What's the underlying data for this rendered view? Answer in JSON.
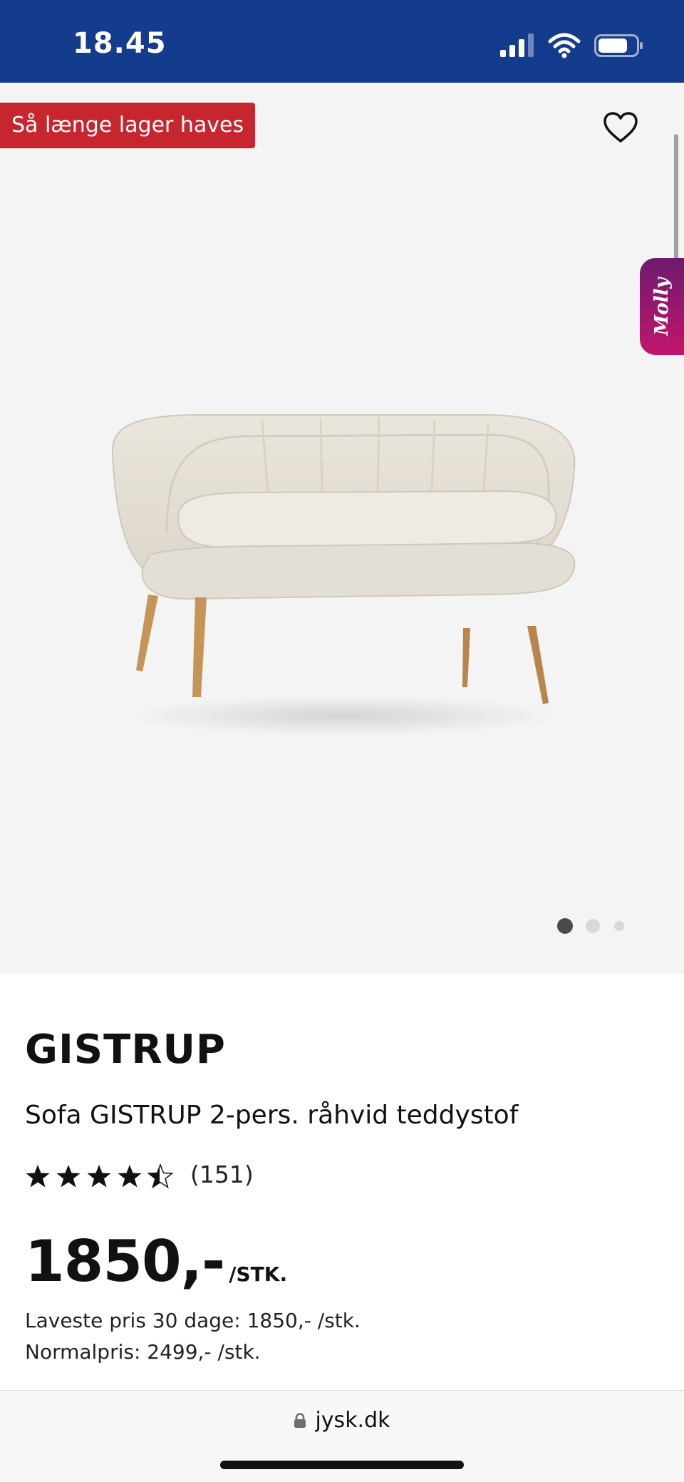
{
  "status_bar": {
    "time": "18.45",
    "background": "#143c8c"
  },
  "gallery": {
    "badge": "Så længe lager haves",
    "badge_color": "#c8262e",
    "assistant_tab_label": "Molly",
    "image_count": 3,
    "active_image": 1
  },
  "product": {
    "brand": "GISTRUP",
    "name": "Sofa GISTRUP 2-pers. råhvid teddystof",
    "rating": 4.5,
    "rating_max": 5,
    "review_count": "(151)",
    "price": "1850,-",
    "price_unit": "/STK.",
    "lowest_price": "Laveste pris 30 dage: 1850,- /stk.",
    "normal_price": "Normalpris: 2499,- /stk."
  },
  "browser": {
    "url": "jysk.dk"
  }
}
